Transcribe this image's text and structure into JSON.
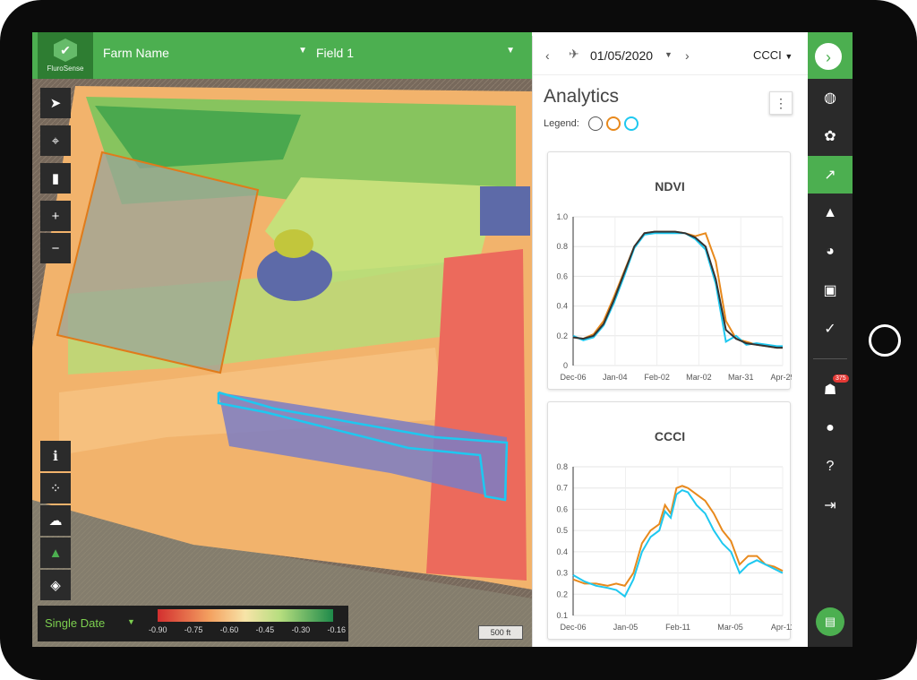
{
  "app": {
    "brand": "FluroSense"
  },
  "header": {
    "farm_label": "Farm Name",
    "field_label": "Field 1"
  },
  "map": {
    "legend_mode": "Single Date",
    "legend_ticks": [
      "-0.90",
      "-0.75",
      "-0.60",
      "-0.45",
      "-0.30",
      "-0.16"
    ],
    "scale_label": "500 ft",
    "colors": {
      "zone_orange": "#e07b1a",
      "zone_cyan": "#1ec8f0"
    }
  },
  "panel": {
    "date": "01/05/2020",
    "index_select": "CCCI",
    "title": "Analytics",
    "legend_label": "Legend:"
  },
  "rail": {
    "notifications_badge": "375"
  },
  "colors": {
    "accent": "#4caf50",
    "series_orange": "#e8891c",
    "series_cyan": "#1ec8f0",
    "series_dark": "#333333"
  },
  "chart_data": [
    {
      "type": "line",
      "title": "NDVI",
      "ylim": [
        0,
        1.0
      ],
      "yticks": [
        "0",
        "0.2",
        "0.4",
        "0.6",
        "0.8",
        "1.0"
      ],
      "xticks": [
        "Dec-06",
        "Jan-04",
        "Feb-02",
        "Mar-02",
        "Mar-31",
        "Apr-29"
      ],
      "x": [
        0,
        7,
        14,
        21,
        28,
        35,
        42,
        49,
        56,
        63,
        70,
        77,
        84,
        91,
        98,
        105,
        112,
        119,
        126,
        133,
        140,
        144
      ],
      "series": [
        {
          "color": "#e8891c",
          "values": [
            0.19,
            0.18,
            0.21,
            0.3,
            0.46,
            0.63,
            0.8,
            0.89,
            0.9,
            0.9,
            0.9,
            0.89,
            0.87,
            0.89,
            0.7,
            0.3,
            0.18,
            0.16,
            0.14,
            0.13,
            0.12,
            0.12
          ]
        },
        {
          "color": "#1ec8f0",
          "values": [
            0.2,
            0.17,
            0.19,
            0.27,
            0.42,
            0.6,
            0.79,
            0.88,
            0.89,
            0.89,
            0.89,
            0.89,
            0.85,
            0.78,
            0.55,
            0.16,
            0.2,
            0.14,
            0.15,
            0.14,
            0.13,
            0.13
          ]
        },
        {
          "color": "#333333",
          "values": [
            0.19,
            0.18,
            0.2,
            0.28,
            0.44,
            0.62,
            0.8,
            0.89,
            0.9,
            0.9,
            0.9,
            0.89,
            0.86,
            0.8,
            0.58,
            0.24,
            0.18,
            0.15,
            0.14,
            0.13,
            0.12,
            0.12
          ]
        }
      ]
    },
    {
      "type": "line",
      "title": "CCCI",
      "ylim": [
        0.1,
        0.8
      ],
      "yticks": [
        "0.1",
        "0.2",
        "0.3",
        "0.4",
        "0.5",
        "0.6",
        "0.7",
        "0.8"
      ],
      "xticks": [
        "Dec-06",
        "Jan-05",
        "Feb-11",
        "Mar-05",
        "Apr-11"
      ],
      "x": [
        0,
        8,
        16,
        24,
        30,
        36,
        42,
        48,
        54,
        60,
        64,
        68,
        72,
        76,
        80,
        86,
        92,
        98,
        104,
        110,
        116,
        122,
        128,
        134,
        140,
        146
      ],
      "series": [
        {
          "color": "#e8891c",
          "values": [
            0.27,
            0.25,
            0.25,
            0.24,
            0.25,
            0.24,
            0.3,
            0.44,
            0.5,
            0.53,
            0.62,
            0.58,
            0.7,
            0.71,
            0.7,
            0.67,
            0.64,
            0.58,
            0.5,
            0.45,
            0.34,
            0.38,
            0.38,
            0.34,
            0.33,
            0.31
          ]
        },
        {
          "color": "#1ec8f0",
          "values": [
            0.29,
            0.26,
            0.24,
            0.23,
            0.22,
            0.19,
            0.27,
            0.4,
            0.47,
            0.5,
            0.59,
            0.56,
            0.67,
            0.69,
            0.68,
            0.62,
            0.58,
            0.5,
            0.44,
            0.4,
            0.3,
            0.34,
            0.36,
            0.34,
            0.32,
            0.3
          ]
        }
      ]
    }
  ]
}
